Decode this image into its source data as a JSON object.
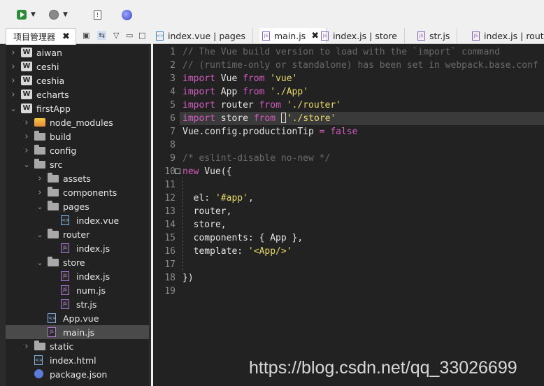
{
  "sidebar": {
    "tab_title": "项目管理器",
    "tab_close": "✖",
    "tree": [
      {
        "label": "aiwan",
        "icon": "project-icon",
        "depth": 0,
        "expanded": false
      },
      {
        "label": "ceshi",
        "icon": "project-icon",
        "depth": 0,
        "expanded": false
      },
      {
        "label": "ceshia",
        "icon": "project-icon",
        "depth": 0,
        "expanded": false
      },
      {
        "label": "echarts",
        "icon": "project-icon",
        "depth": 0,
        "expanded": false
      },
      {
        "label": "firstApp",
        "icon": "project-icon",
        "depth": 0,
        "expanded": true
      },
      {
        "label": "node_modules",
        "icon": "node-modules-icon",
        "depth": 1,
        "expanded": false
      },
      {
        "label": "build",
        "icon": "folder-icon",
        "depth": 1,
        "expanded": false
      },
      {
        "label": "config",
        "icon": "folder-icon",
        "depth": 1,
        "expanded": false
      },
      {
        "label": "src",
        "icon": "folder-icon",
        "depth": 1,
        "expanded": true
      },
      {
        "label": "assets",
        "icon": "folder-icon",
        "depth": 2,
        "expanded": false
      },
      {
        "label": "components",
        "icon": "folder-icon",
        "depth": 2,
        "expanded": false
      },
      {
        "label": "pages",
        "icon": "folder-icon",
        "depth": 2,
        "expanded": true
      },
      {
        "label": "index.vue",
        "icon": "vue-file-icon",
        "depth": 3
      },
      {
        "label": "router",
        "icon": "folder-icon",
        "depth": 2,
        "expanded": true
      },
      {
        "label": "index.js",
        "icon": "js-file-icon",
        "depth": 3
      },
      {
        "label": "store",
        "icon": "folder-icon",
        "depth": 2,
        "expanded": true
      },
      {
        "label": "index.js",
        "icon": "js-file-icon",
        "depth": 3
      },
      {
        "label": "num.js",
        "icon": "js-file-icon",
        "depth": 3
      },
      {
        "label": "str.js",
        "icon": "js-file-icon",
        "depth": 3
      },
      {
        "label": "App.vue",
        "icon": "vue-file-icon",
        "depth": 2
      },
      {
        "label": "main.js",
        "icon": "js-file-icon",
        "depth": 2,
        "selected": true
      },
      {
        "label": "static",
        "icon": "folder-icon",
        "depth": 1,
        "expanded": false
      },
      {
        "label": "index.html",
        "icon": "html-file-icon",
        "depth": 1
      },
      {
        "label": "package.json",
        "icon": "json-file-icon",
        "depth": 1
      }
    ]
  },
  "editor": {
    "tabs": [
      {
        "label": "index.vue | pages",
        "icon": "vue-file-icon",
        "active": false
      },
      {
        "label": "main.js",
        "icon": "js-file-icon",
        "active": true
      },
      {
        "label": "index.js | store",
        "icon": "js-file-icon",
        "active": false
      },
      {
        "label": "str.js",
        "icon": "js-file-icon",
        "active": false
      },
      {
        "label": "index.js | route",
        "icon": "js-file-icon",
        "active": false
      }
    ],
    "active_tab_close": "✖",
    "lines": [
      [
        [
          "c-com",
          "// The Vue build version to load with the `import` command"
        ]
      ],
      [
        [
          "c-com",
          "// (runtime-only or standalone) has been set in webpack.base.conf"
        ]
      ],
      [
        [
          "c-kw",
          "import"
        ],
        [
          "",
          " Vue "
        ],
        [
          "c-kw",
          "from"
        ],
        [
          "",
          " "
        ],
        [
          "c-str",
          "'vue'"
        ]
      ],
      [
        [
          "c-kw",
          "import"
        ],
        [
          "",
          " App "
        ],
        [
          "c-kw",
          "from"
        ],
        [
          "",
          " "
        ],
        [
          "c-str",
          "'./App'"
        ]
      ],
      [
        [
          "c-kw",
          "import"
        ],
        [
          "",
          " router "
        ],
        [
          "c-kw",
          "from"
        ],
        [
          "",
          " "
        ],
        [
          "c-str",
          "'./router'"
        ]
      ],
      [
        [
          "c-kw",
          "import"
        ],
        [
          "",
          " store "
        ],
        [
          "c-kw",
          "from"
        ],
        [
          "",
          " "
        ],
        [
          "cursor",
          ""
        ],
        [
          "c-str",
          "'./store'"
        ]
      ],
      [
        [
          "",
          "Vue.config.productionTip "
        ],
        [
          "c-op",
          "="
        ],
        [
          "",
          " "
        ],
        [
          "c-kw",
          "false"
        ]
      ],
      [],
      [
        [
          "c-com",
          "/* eslint-disable no-new */"
        ]
      ],
      [
        [
          "c-kw",
          "new"
        ],
        [
          "",
          " Vue({"
        ]
      ],
      [],
      [
        [
          "",
          "  el: "
        ],
        [
          "c-str",
          "'#app'"
        ],
        [
          "",
          ","
        ]
      ],
      [
        [
          "",
          "  router,"
        ]
      ],
      [
        [
          "",
          "  store,"
        ]
      ],
      [
        [
          "",
          "  components: { App },"
        ]
      ],
      [
        [
          "",
          "  template: "
        ],
        [
          "c-str",
          "'<App/>'"
        ]
      ],
      [],
      [
        [
          "",
          "})"
        ]
      ],
      []
    ],
    "highlighted_line": 6,
    "fold_line": 10
  },
  "watermark": "https://blog.csdn.net/qq_33026699"
}
